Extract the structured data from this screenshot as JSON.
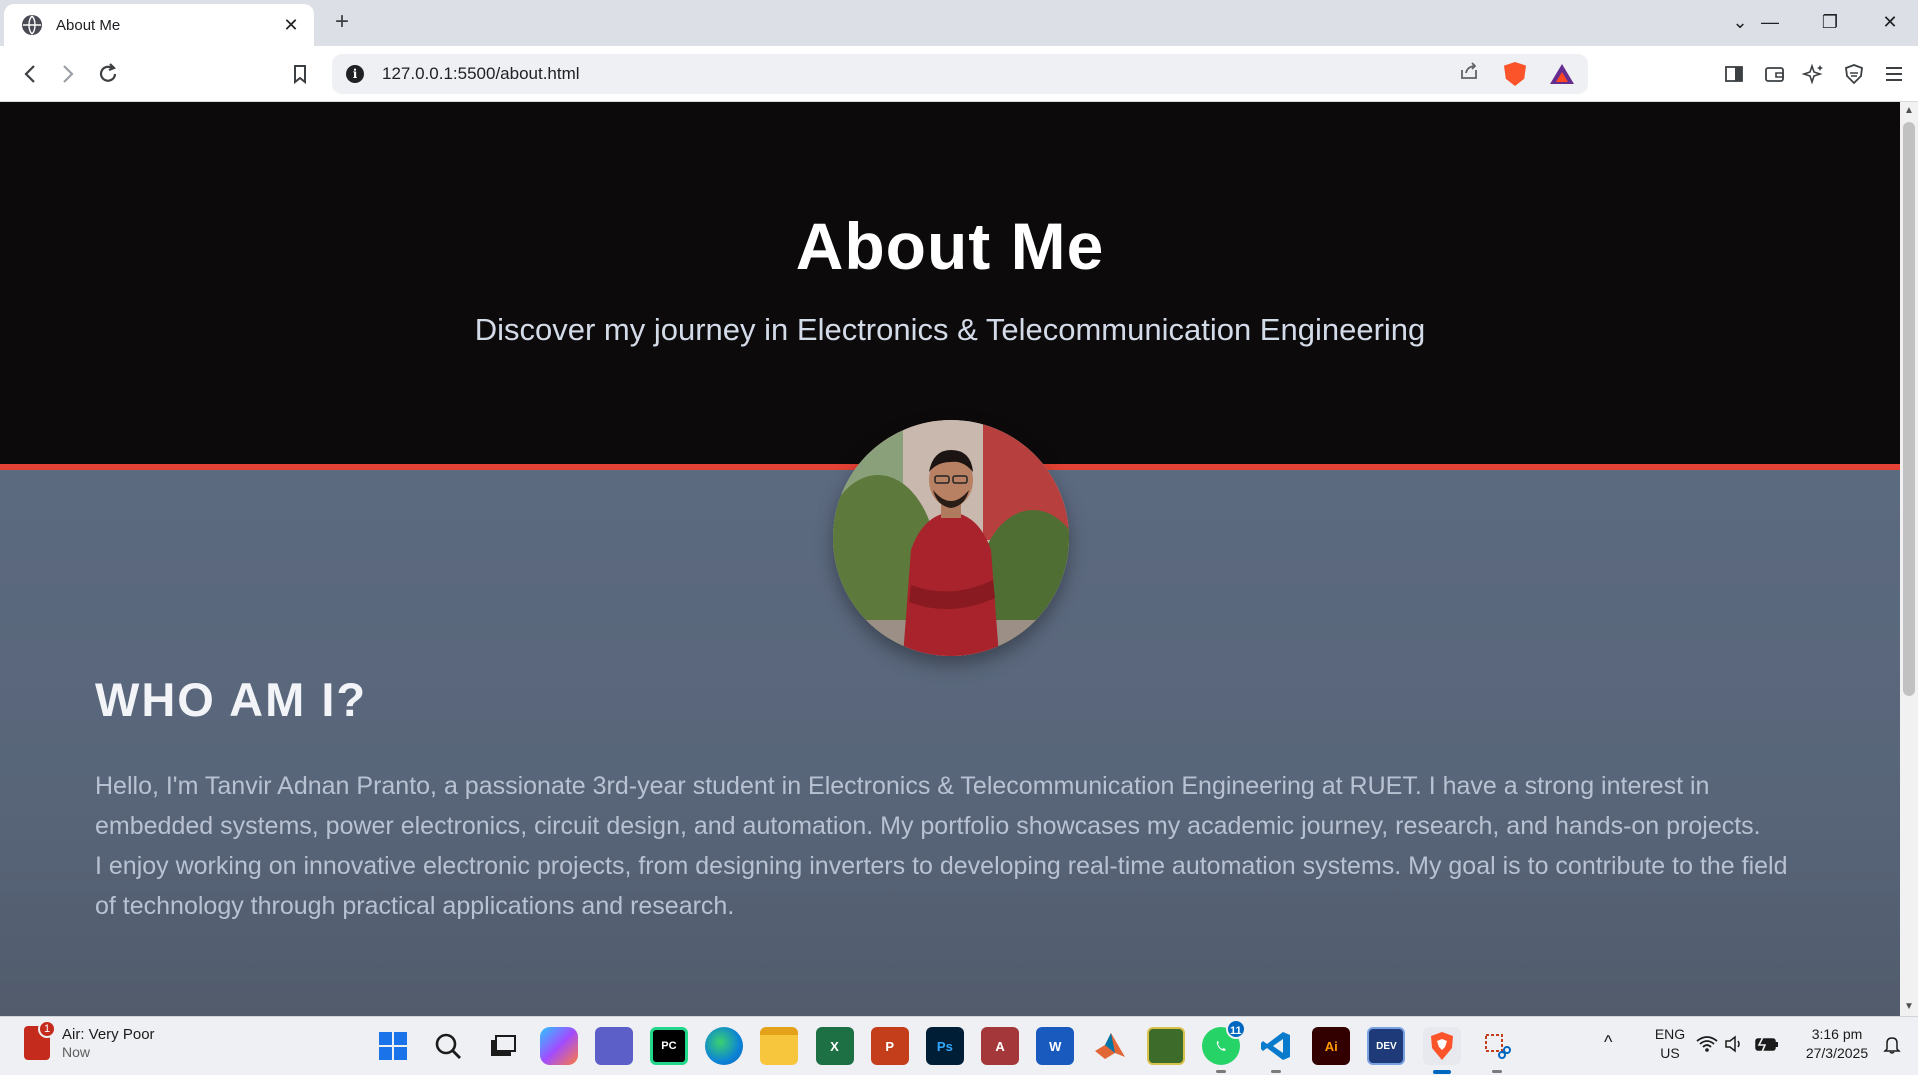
{
  "browser": {
    "tab_title": "About Me",
    "tab_close": "✕",
    "new_tab": "+",
    "url": "127.0.0.1:5500/about.html",
    "icons": {
      "back": "back-arrow-icon",
      "forward": "forward-arrow-icon",
      "reload": "reload-icon",
      "bookmark": "bookmark-icon",
      "info": "info-icon",
      "share": "share-icon",
      "brave_shield": "brave-shield-icon",
      "rewards": "brave-rewards-icon",
      "sidebar": "sidebar-icon",
      "wallet": "wallet-icon",
      "leo": "leo-ai-icon",
      "vpn": "vpn-icon",
      "menu": "hamburger-menu-icon"
    }
  },
  "page": {
    "hero_title": "About Me",
    "hero_subtitle": "Discover my journey in Electronics & Telecommunication Engineering",
    "section_title": "WHO AM I?",
    "bio_lines": [
      "Hello, I'm Tanvir Adnan Pranto, a passionate 3rd-year student in Electronics & Telecommunication Engineering at RUET. I have a strong interest in",
      "embedded systems, power electronics, circuit design, and automation. My portfolio showcases my academic journey, research, and hands-on projects.",
      "I enjoy working on innovative electronic projects, from designing inverters to developing real-time automation systems. My goal is to contribute to the field",
      "of technology through practical applications and research."
    ],
    "colors": {
      "hero_bg": "#0d0a0b",
      "accent": "#e34234",
      "section_bg": "#5c6a80"
    }
  },
  "taskbar": {
    "weather_title": "Air: Very Poor",
    "weather_sub": "Now",
    "weather_badge": "1",
    "apps": [
      {
        "name": "start",
        "label": ""
      },
      {
        "name": "search",
        "label": ""
      },
      {
        "name": "task-view",
        "label": ""
      },
      {
        "name": "copilot",
        "label": ""
      },
      {
        "name": "teams",
        "label": ""
      },
      {
        "name": "pycharm",
        "label": "PC"
      },
      {
        "name": "edge",
        "label": ""
      },
      {
        "name": "file-explorer",
        "label": ""
      },
      {
        "name": "excel",
        "label": "X"
      },
      {
        "name": "powerpoint",
        "label": "P"
      },
      {
        "name": "photoshop",
        "label": "Ps"
      },
      {
        "name": "access",
        "label": "A"
      },
      {
        "name": "word",
        "label": "W"
      },
      {
        "name": "matlab",
        "label": ""
      },
      {
        "name": "proteus",
        "label": ""
      },
      {
        "name": "whatsapp",
        "label": "",
        "badge": "11"
      },
      {
        "name": "vscode",
        "label": ""
      },
      {
        "name": "illustrator",
        "label": "Ai"
      },
      {
        "name": "devcpp",
        "label": "DEV"
      },
      {
        "name": "brave",
        "label": ""
      },
      {
        "name": "snipping-tool",
        "label": ""
      }
    ],
    "tray_chevron": "^",
    "language_top": "ENG",
    "language_bottom": "US",
    "time": "3:16 pm",
    "date": "27/3/2025"
  }
}
